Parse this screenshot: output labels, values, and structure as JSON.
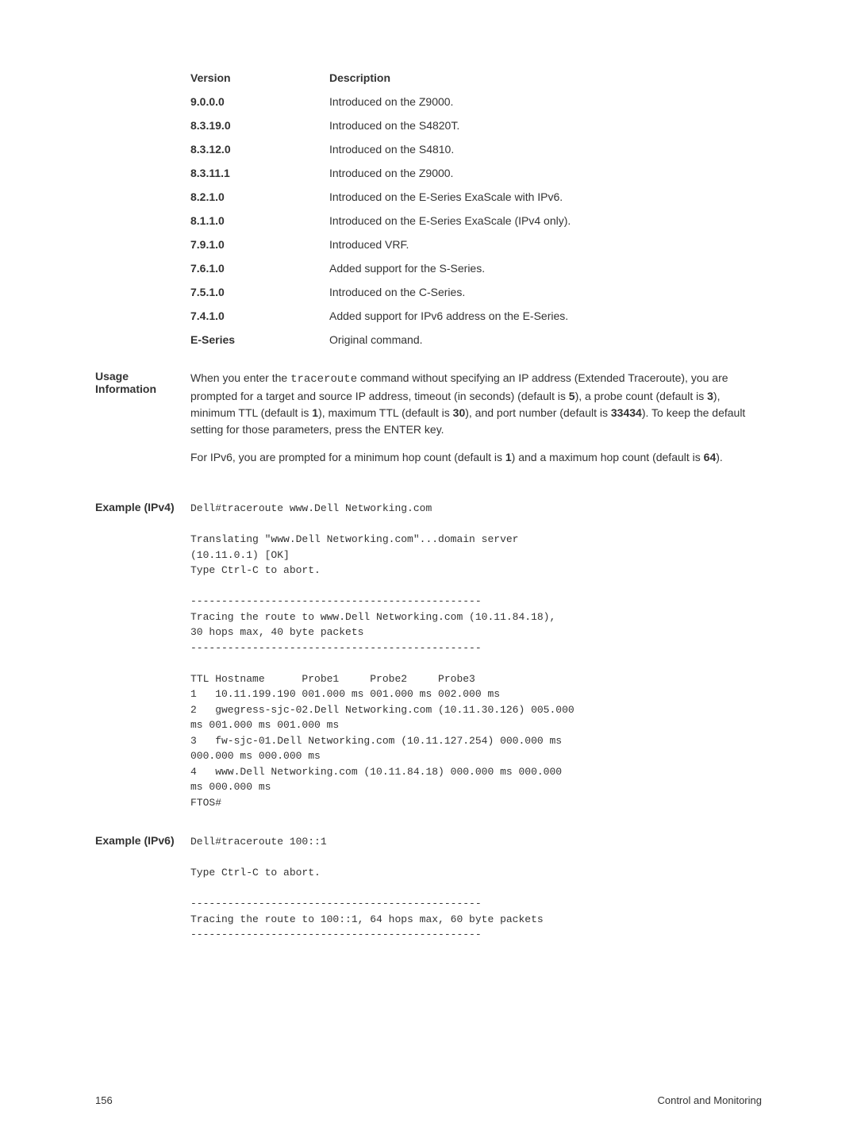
{
  "version_table": {
    "headers": {
      "version": "Version",
      "description": "Description"
    },
    "rows": [
      {
        "version": "9.0.0.0",
        "description": "Introduced on the Z9000."
      },
      {
        "version": "8.3.19.0",
        "description": "Introduced on the S4820T."
      },
      {
        "version": "8.3.12.0",
        "description": "Introduced on the S4810."
      },
      {
        "version": "8.3.11.1",
        "description": "Introduced on the Z9000."
      },
      {
        "version": "8.2.1.0",
        "description": "Introduced on the E-Series ExaScale with IPv6."
      },
      {
        "version": "8.1.1.0",
        "description": "Introduced on the E-Series ExaScale (IPv4 only)."
      },
      {
        "version": "7.9.1.0",
        "description": "Introduced VRF."
      },
      {
        "version": "7.6.1.0",
        "description": "Added support for the S-Series."
      },
      {
        "version": "7.5.1.0",
        "description": "Introduced on the C-Series."
      },
      {
        "version": "7.4.1.0",
        "description": "Added support for IPv6 address on the E-Series."
      },
      {
        "version": "E-Series",
        "description": "Original command."
      }
    ]
  },
  "usage": {
    "label": "Usage\nInformation",
    "p1a": "When you enter the ",
    "p1cmd": "traceroute",
    "p1b": " command without specifying an IP address (Extended Traceroute), you are prompted for a target and source IP address, timeout (in seconds) (default is ",
    "p1c": "5",
    "p1d": "), a probe count (default is ",
    "p1e": "3",
    "p1f": "), minimum TTL (default is ",
    "p1g": "1",
    "p1h": "), maximum TTL (default is ",
    "p1i": "30",
    "p1j": "), and port number (default is ",
    "p1k": "33434",
    "p1l": "). To keep the default setting for those parameters, press the ENTER key.",
    "p2a": "For IPv6, you are prompted for a minimum hop count (default is ",
    "p2b": "1",
    "p2c": ") and a maximum hop count (default is ",
    "p2d": "64",
    "p2e": ")."
  },
  "example_ipv4": {
    "label": "Example (IPv4)",
    "code": "Dell#traceroute www.Dell Networking.com\n\nTranslating \"www.Dell Networking.com\"...domain server\n(10.11.0.1) [OK]\nType Ctrl-C to abort.\n\n-----------------------------------------------\nTracing the route to www.Dell Networking.com (10.11.84.18),\n30 hops max, 40 byte packets\n-----------------------------------------------\n\nTTL Hostname      Probe1     Probe2     Probe3\n1   10.11.199.190 001.000 ms 001.000 ms 002.000 ms\n2   gwegress-sjc-02.Dell Networking.com (10.11.30.126) 005.000\nms 001.000 ms 001.000 ms\n3   fw-sjc-01.Dell Networking.com (10.11.127.254) 000.000 ms\n000.000 ms 000.000 ms\n4   www.Dell Networking.com (10.11.84.18) 000.000 ms 000.000\nms 000.000 ms\nFTOS#"
  },
  "example_ipv6": {
    "label": "Example (IPv6)",
    "code": "Dell#traceroute 100::1\n\nType Ctrl-C to abort.\n\n-----------------------------------------------\nTracing the route to 100::1, 64 hops max, 60 byte packets\n-----------------------------------------------"
  },
  "footer": {
    "page": "156",
    "title": "Control and Monitoring"
  }
}
